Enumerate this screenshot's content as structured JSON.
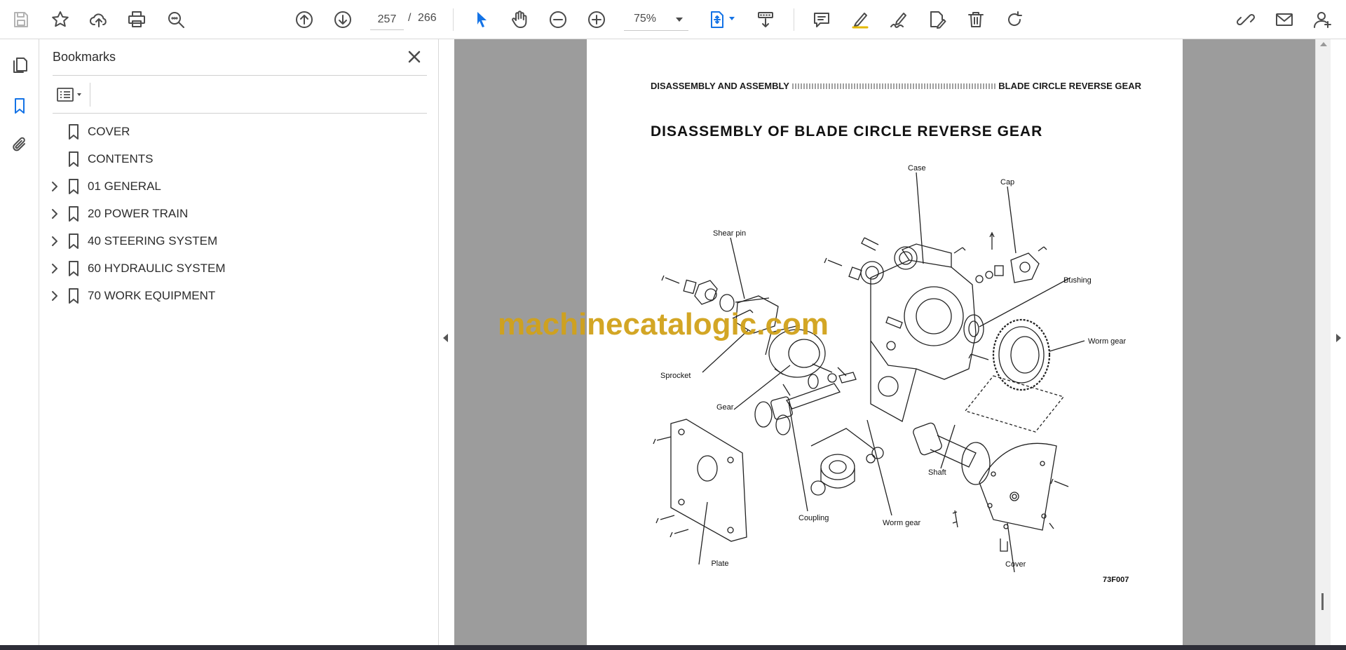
{
  "toolbar": {
    "page_current": "257",
    "page_separator": "/",
    "page_total": "266",
    "zoom": "75%"
  },
  "bookmarks": {
    "title": "Bookmarks",
    "items": [
      {
        "label": "COVER",
        "expandable": false
      },
      {
        "label": "CONTENTS",
        "expandable": false
      },
      {
        "label": "01 GENERAL",
        "expandable": true
      },
      {
        "label": "20 POWER TRAIN",
        "expandable": true
      },
      {
        "label": "40 STEERING SYSTEM",
        "expandable": true
      },
      {
        "label": "60 HYDRAULIC SYSTEM",
        "expandable": true
      },
      {
        "label": "70 WORK EQUIPMENT",
        "expandable": true
      }
    ]
  },
  "document": {
    "header_left": "DISASSEMBLY AND ASSEMBLY",
    "header_right": "BLADE CIRCLE REVERSE GEAR",
    "title": "DISASSEMBLY OF BLADE CIRCLE REVERSE GEAR",
    "labels": {
      "case": "Case",
      "cap": "Cap",
      "shear_pin": "Shear pin",
      "bushing": "Bushing",
      "worm_gear_top": "Worm gear",
      "sprocket": "Sprocket",
      "gear": "Gear",
      "shaft": "Shaft",
      "coupling": "Coupling",
      "worm_gear_bottom": "Worm gear",
      "plate": "Plate",
      "cover": "Cover"
    },
    "figure_code": "73F007",
    "watermark": "machinecatalogic.com"
  }
}
